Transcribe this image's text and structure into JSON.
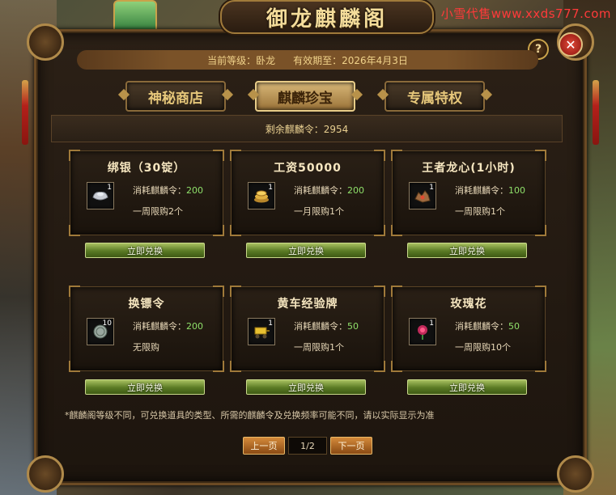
{
  "watermark": "小雪代售www.xxds777.com",
  "window": {
    "title": "御龙麒麟阁",
    "help_symbol": "?",
    "close_symbol": "✕"
  },
  "header": {
    "level_label": "当前等级：卧龙",
    "expiry_label": "有效期至：2026年4月3日"
  },
  "tabs": [
    {
      "label": "神秘商店",
      "active": false
    },
    {
      "label": "麒麟珍宝",
      "active": true
    },
    {
      "label": "专属特权",
      "active": false
    }
  ],
  "tokens": {
    "remaining_label": "剩余麒麟令：2954"
  },
  "cost_prefix": "消耗麒麟令：",
  "items": [
    {
      "name": "绑银（30锭）",
      "qty": "1",
      "cost": "200",
      "limit": "一周限购2个",
      "icon": "silver-ingot-icon",
      "redeem": "立即兑换"
    },
    {
      "name": "工资50000",
      "qty": "1",
      "cost": "200",
      "limit": "一月限购1个",
      "icon": "gold-coins-icon",
      "redeem": "立即兑换"
    },
    {
      "name": "王者龙心(1小时)",
      "qty": "1",
      "cost": "100",
      "limit": "一周限购1个",
      "icon": "dragon-heart-icon",
      "redeem": "立即兑换"
    },
    {
      "name": "换镖令",
      "qty": "10",
      "cost": "200",
      "limit": "无限购",
      "icon": "escort-token-icon",
      "redeem": "立即兑换"
    },
    {
      "name": "黄车经验牌",
      "qty": "1",
      "cost": "50",
      "limit": "一周限购1个",
      "icon": "yellow-cart-icon",
      "redeem": "立即兑换"
    },
    {
      "name": "玫瑰花",
      "qty": "1",
      "cost": "50",
      "limit": "一周限购10个",
      "icon": "rose-icon",
      "redeem": "立即兑换"
    }
  ],
  "note": "*麒麟阁等级不同，可兑换道具的类型、所需的麒麟令及兑换频率可能不同，请以实际显示为准",
  "pager": {
    "prev": "上一页",
    "page": "1/2",
    "next": "下一页"
  },
  "colors": {
    "accent_gold": "#f0d28a",
    "cost_green": "#8fe06a",
    "redeem_green": "#5a7a24",
    "close_red": "#c0281c"
  }
}
